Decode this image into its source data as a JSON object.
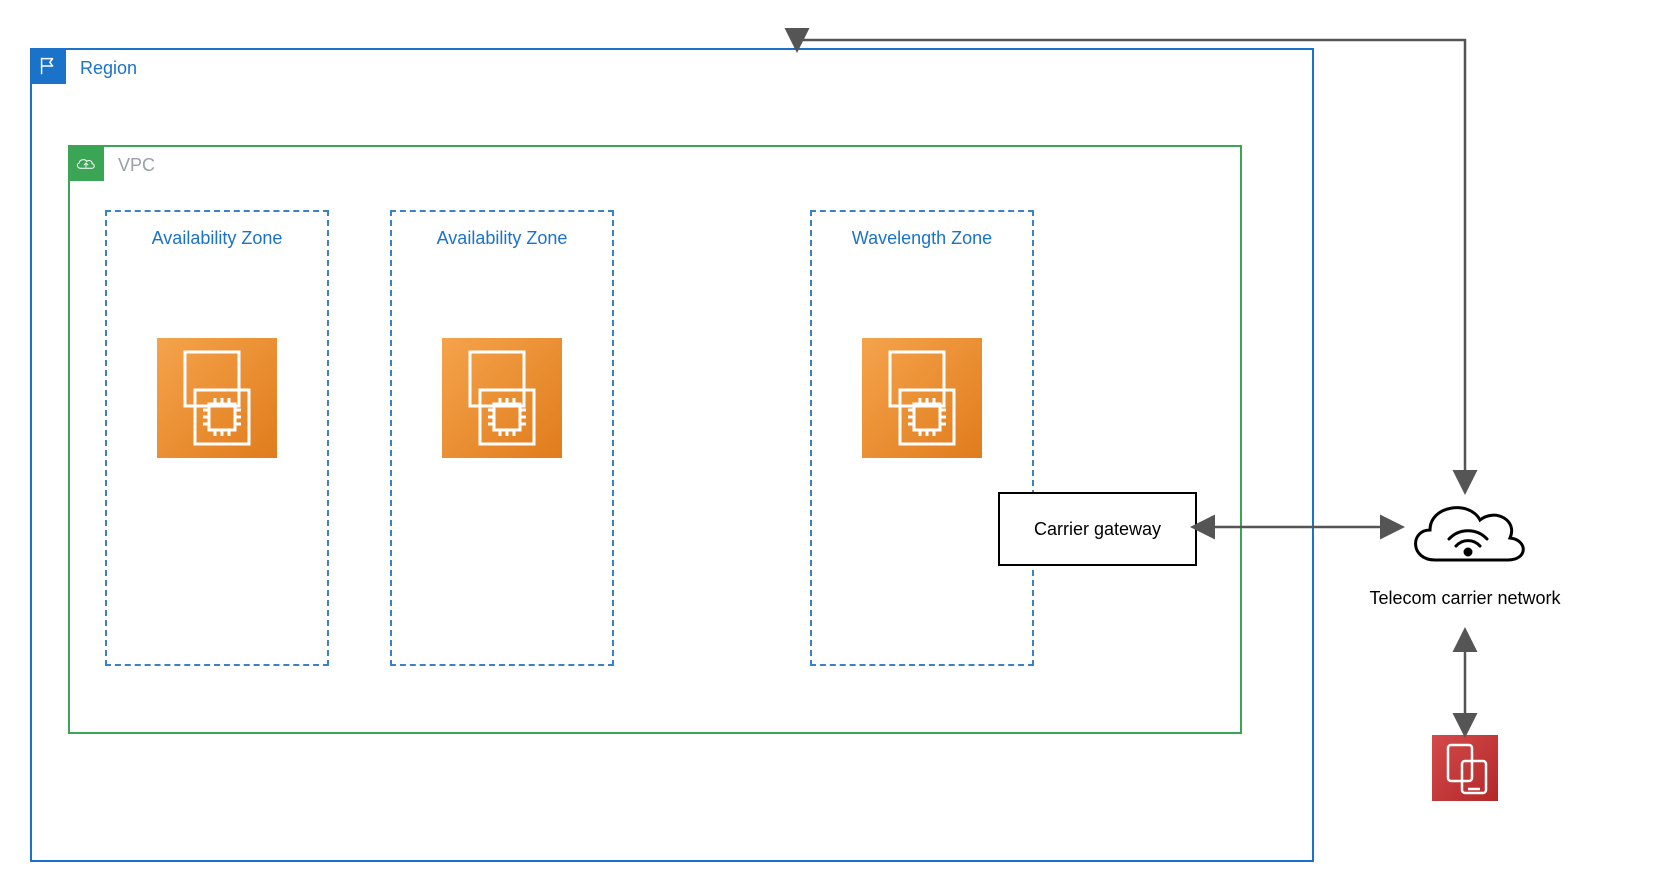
{
  "region": {
    "label": "Region"
  },
  "vpc": {
    "label": "VPC"
  },
  "zones": {
    "az1": "Availability Zone",
    "az2": "Availability Zone",
    "wz": "Wavelength Zone"
  },
  "carrier_gateway": "Carrier gateway",
  "telecom_label": "Telecom carrier network",
  "colors": {
    "region_border": "#1a73c8",
    "vpc_border": "#3aa655",
    "zone_border": "#3b82c4",
    "ec2_orange": "#e8891b",
    "mobile_red": "#c73a3a"
  }
}
